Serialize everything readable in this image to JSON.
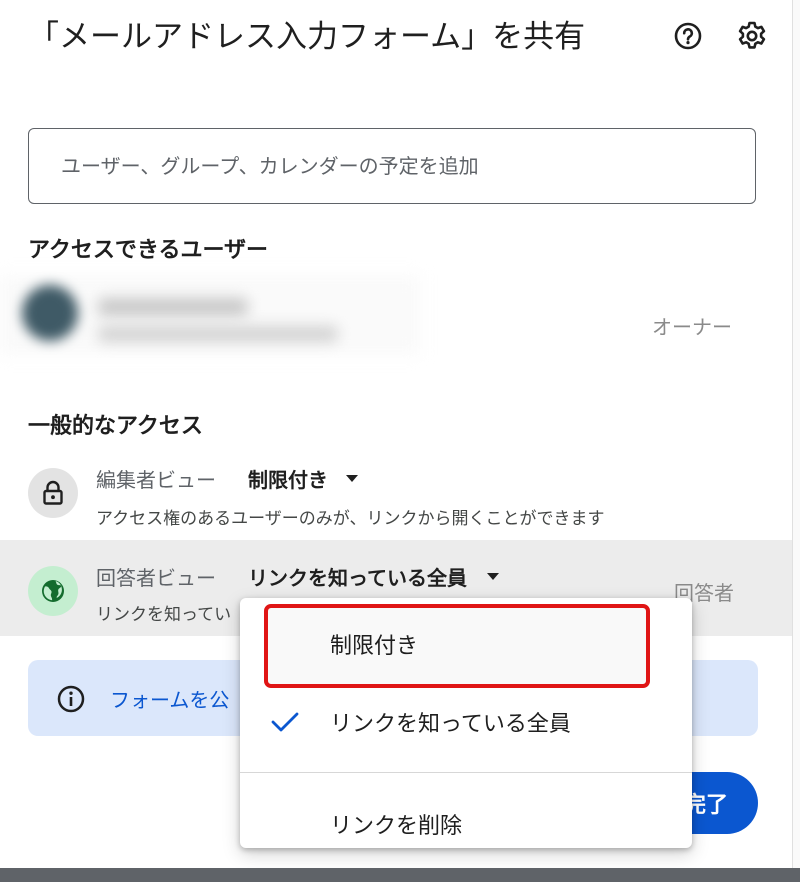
{
  "dialog": {
    "title": "「メールアドレス入力フォーム」を共有",
    "help_icon": "help-icon",
    "settings_icon": "gear-icon"
  },
  "add_people": {
    "placeholder": "ユーザー、グループ、カレンダーの予定を追加"
  },
  "people_with_access": {
    "heading": "アクセスできるユーザー",
    "owner_role": "オーナー"
  },
  "general_access": {
    "heading": "一般的なアクセス",
    "editor_view": {
      "label": "編集者ビュー",
      "value": "制限付き",
      "description": "アクセス権のあるユーザーのみが、リンクから開くことができます"
    },
    "responder_view": {
      "label": "回答者ビュー",
      "value": "リンクを知っている全員",
      "description": "リンクを知ってい",
      "role": "回答者"
    }
  },
  "info_banner": {
    "text": "フォームを公"
  },
  "done_button": {
    "label": "完了"
  },
  "dropdown_menu": {
    "items": [
      {
        "label": "制限付き",
        "selected": false
      },
      {
        "label": "リンクを知っている全員",
        "selected": true
      },
      {
        "label": "リンクを削除",
        "selected": false
      }
    ]
  },
  "colors": {
    "accent": "#0b57d0",
    "highlight_outline": "#e01515",
    "banner_bg": "#dbe7fb",
    "globe_bg": "#c4eed0",
    "globe_fg": "#146c2e"
  }
}
